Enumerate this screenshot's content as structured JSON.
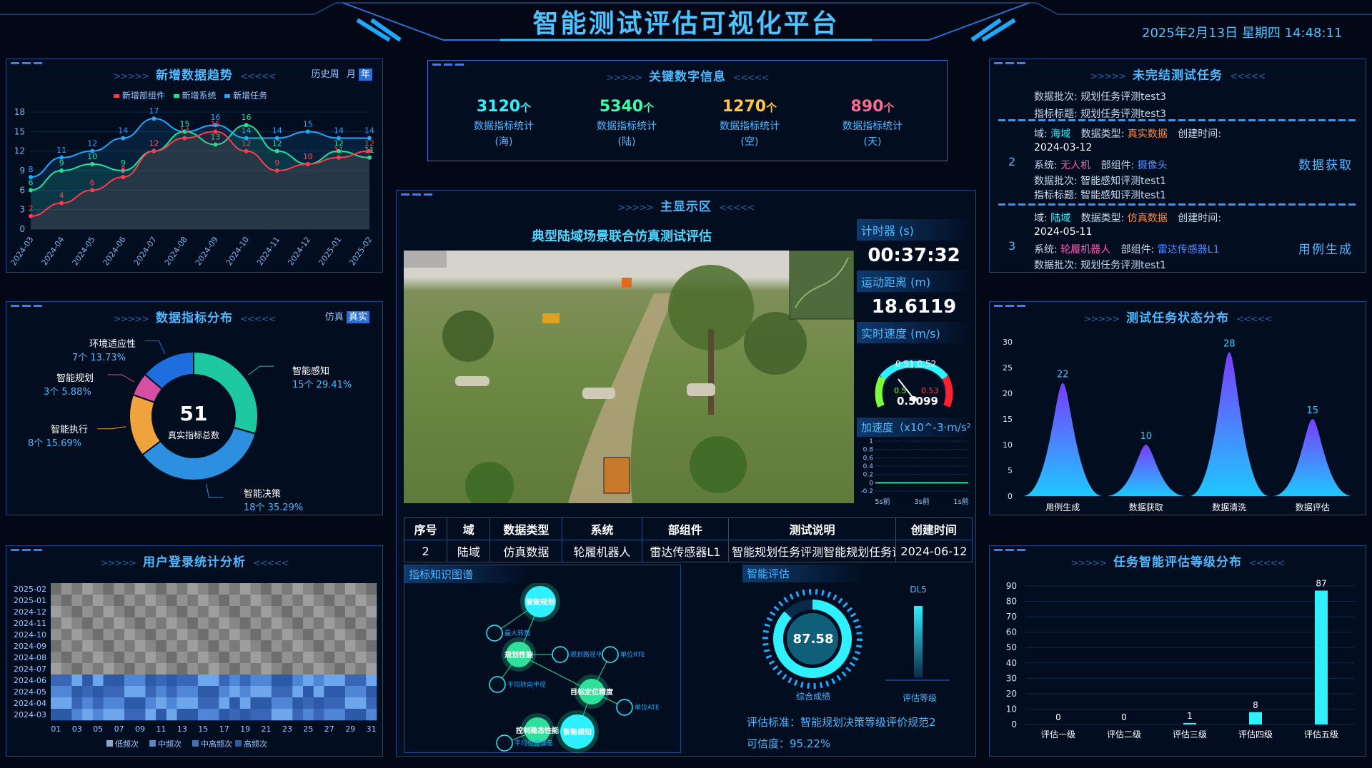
{
  "header": {
    "title": "智能测试评估可视化平台",
    "datetime": "2025年2月13日 星期四 14:48:11"
  },
  "trend": {
    "title": "新增数据趋势",
    "toggle": {
      "opt1": "历史周",
      "opt2": "月",
      "opt3": "年"
    },
    "legend": [
      "新增部组件",
      "新增系统",
      "新增任务"
    ]
  },
  "distribution": {
    "title": "数据指标分布",
    "toggle": {
      "opt1": "仿真",
      "opt2": "真实"
    },
    "center_value": "51",
    "center_label": "真实指标总数",
    "labels": [
      {
        "name": "智能感知",
        "value": "15个  29.41%"
      },
      {
        "name": "智能决策",
        "value": "18个  35.29%"
      },
      {
        "name": "智能执行",
        "value": "8个  15.69%"
      },
      {
        "name": "智能规划",
        "value": "3个  5.88%"
      },
      {
        "name": "环境适应性",
        "value": "7个  13.73%"
      }
    ]
  },
  "login": {
    "title": "用户登录统计分析",
    "rows": [
      "2025-02",
      "2025-01",
      "2024-12",
      "2024-11",
      "2024-10",
      "2024-09",
      "2024-08",
      "2024-07",
      "2024-06",
      "2024-05",
      "2024-04",
      "2024-03"
    ],
    "cols": [
      "01",
      "03",
      "05",
      "07",
      "09",
      "11",
      "13",
      "15",
      "17",
      "19",
      "21",
      "23",
      "25",
      "27",
      "29",
      "31"
    ],
    "legend": [
      "低频次",
      "中频次",
      "中高频次",
      "高频次"
    ]
  },
  "keynums": {
    "title": "关键数字信息",
    "items": [
      {
        "value": "3120",
        "unit": "个",
        "label1": "数据指标统计",
        "label2": "(海)",
        "color": "#2ff0ff"
      },
      {
        "value": "5340",
        "unit": "个",
        "label1": "数据指标统计",
        "label2": "(陆)",
        "color": "#3dffa8"
      },
      {
        "value": "1270",
        "unit": "个",
        "label1": "数据指标统计",
        "label2": "(空)",
        "color": "#ffc640"
      },
      {
        "value": "890",
        "unit": "个",
        "label1": "数据指标统计",
        "label2": "(天)",
        "color": "#ff6b8f"
      }
    ]
  },
  "main": {
    "title": "主显示区",
    "scene_title": "典型陆域场景联合仿真测试评估",
    "timer_label": "计时器 (s)",
    "timer_value": "00:37:32",
    "distance_label": "运动距离 (m)",
    "distance_value": "18.6119",
    "speed_label": "实时速度 (m/s)",
    "gauge": {
      "ticks_top": "0.51 0.52",
      "tick_l": "0.5",
      "tick_r": "0.53",
      "value": "0.5099"
    },
    "accel_label": "加速度（x10^-3·m/s²）",
    "accel_axis": [
      "1",
      "0.8",
      "0.6",
      "0.4",
      "0.2",
      "0",
      "-0.2"
    ],
    "accel_x": [
      "5s前",
      "3s前",
      "1s前"
    ],
    "table": {
      "headers": [
        "序号",
        "域",
        "数据类型",
        "系统",
        "部组件",
        "测试说明",
        "创建时间"
      ],
      "row": [
        "2",
        "陆域",
        "仿真数据",
        "轮履机器人",
        "雷达传感器L1",
        "智能规划任务评测智能规划任务评...",
        "2024-06-12"
      ]
    },
    "kg": {
      "title": "指标知识图谱",
      "nodes": [
        "智能规划",
        "规划性能",
        "目标定位精度",
        "控制稳态性能",
        "智能感知",
        "最大转角",
        "规划路径平滑度",
        "平均转向半径",
        "单位RTE",
        "单位ATE",
        "平均位置误差"
      ]
    },
    "eval": {
      "title": "智能评估",
      "score": "87.58",
      "score_label": "综合成绩",
      "level": "DL5",
      "level_label": "评估等级",
      "standard": "评估标准：智能规划决策等级评价规范2",
      "confidence": "可信度：95.22%"
    }
  },
  "tasks": {
    "title": "未完结测试任务",
    "top": {
      "l1": "数据批次: 规划任务评测test3",
      "l2": "指标标题: 规划任务评测test3"
    },
    "items": [
      {
        "idx": "2",
        "domain_k": "域:",
        "domain_v": "海域",
        "dtype_k": "数据类型:",
        "dtype_v": "真实数据",
        "ctime_k": "创建时间:",
        "ctime_v": "2024-03-12",
        "sys_k": "系统:",
        "sys_v": "无人机",
        "comp_k": "部组件:",
        "comp_v": "摄像头",
        "batch": "数据批次: 智能感知评测test1",
        "ind": "指标标题: 智能感知评测test1",
        "action": "数据获取"
      },
      {
        "idx": "3",
        "domain_k": "域:",
        "domain_v": "陆域",
        "dtype_k": "数据类型:",
        "dtype_v": "仿真数据",
        "ctime_k": "创建时间:",
        "ctime_v": "2024-05-11",
        "sys_k": "系统:",
        "sys_v": "轮履机器人",
        "comp_k": "部组件:",
        "comp_v": "雷达传感器L1",
        "batch": "数据批次: 规划任务评测test1",
        "action": "用例生成"
      }
    ]
  },
  "status": {
    "title": "测试任务状态分布"
  },
  "grade": {
    "title": "任务智能评估等级分布"
  },
  "chart_data": [
    {
      "type": "line",
      "categories": [
        "2024-03",
        "2024-04",
        "2024-05",
        "2024-06",
        "2024-07",
        "2024-08",
        "2024-09",
        "2024-10",
        "2024-11",
        "2024-12",
        "2025-01",
        "2025-02"
      ],
      "series": [
        {
          "name": "新增部组件",
          "values": [
            2,
            4,
            6,
            8,
            12,
            14,
            15,
            12,
            9,
            10,
            11,
            12
          ],
          "color": "#ff3b4e"
        },
        {
          "name": "新增系统",
          "values": [
            6,
            9,
            10,
            9,
            12,
            15,
            13,
            16,
            12,
            10,
            12,
            11
          ],
          "color": "#1ee39a"
        },
        {
          "name": "新增任务",
          "values": [
            8,
            11,
            12,
            14,
            17,
            15,
            16,
            14,
            14,
            15,
            14,
            14
          ],
          "color": "#1ea8ff"
        }
      ],
      "ylim": [
        0,
        18
      ],
      "yticks": [
        0,
        3,
        6,
        9,
        12,
        15,
        18
      ]
    },
    {
      "type": "pie",
      "labels": [
        "智能感知",
        "智能决策",
        "智能执行",
        "智能规划",
        "环境适应性"
      ],
      "values": [
        15,
        18,
        8,
        3,
        7
      ],
      "colors": [
        "#1ec8a0",
        "#2d8fe0",
        "#f0a33c",
        "#d64fa5",
        "#1f6ee0"
      ]
    },
    {
      "type": "heatmap",
      "note": "levels 0-3 per cell",
      "rows": 12,
      "cols": 31
    },
    {
      "type": "area",
      "categories": [
        "用例生成",
        "数据获取",
        "数据清洗",
        "数据评估"
      ],
      "values": [
        22,
        10,
        28,
        15
      ],
      "ylim": [
        0,
        30
      ],
      "yticks": [
        0,
        5,
        10,
        15,
        20,
        25,
        30
      ]
    },
    {
      "type": "bar",
      "categories": [
        "评估一级",
        "评估二级",
        "评估三级",
        "评估四级",
        "评估五级"
      ],
      "values": [
        0,
        0,
        1,
        8,
        87
      ],
      "ylim": [
        0,
        90
      ],
      "yticks": [
        0,
        10,
        20,
        30,
        40,
        50,
        60,
        70,
        80,
        90
      ]
    }
  ]
}
